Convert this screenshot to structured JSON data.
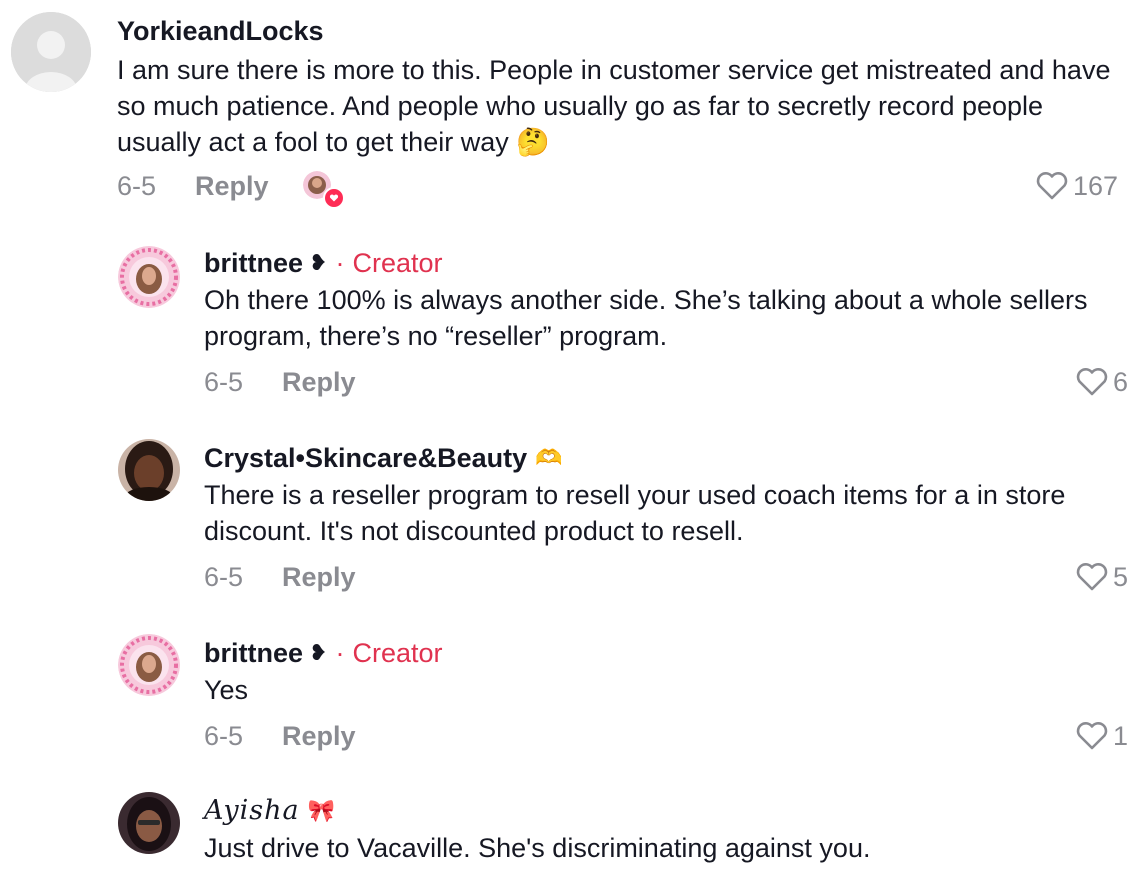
{
  "comments": [
    {
      "username": "YorkieandLocks",
      "text": "I am sure there is more to this. People in customer service get mistreated and have so much patience. And people who usually go as far to secretly record people usually act a fool to get their way 🤔",
      "date": "6-5",
      "reply_label": "Reply",
      "likes": "167"
    },
    {
      "username": "brittnee",
      "creator_label": "Creator",
      "text": "Oh there 100% is always another side. She’s talking about a whole sellers program, there’s no “reseller” program.",
      "date": "6-5",
      "reply_label": "Reply",
      "likes": "6"
    },
    {
      "username": "Crystal•Skincare&Beauty",
      "badge": "🫶",
      "text": "There is a reseller program to resell your used coach items for a in store discount. It's not discounted product to resell.",
      "date": "6-5",
      "reply_label": "Reply",
      "likes": "5"
    },
    {
      "username": "brittnee",
      "creator_label": "Creator",
      "text": "Yes",
      "date": "6-5",
      "reply_label": "Reply",
      "likes": "1"
    },
    {
      "username": "Ayisha",
      "badge": "🎀",
      "text": "Just drive to Vacaville. She's discriminating against you."
    }
  ],
  "colors": {
    "creator": "#e0324f",
    "muted": "#8a8b91",
    "text": "#161823",
    "like_badge": "#fe2c55"
  }
}
